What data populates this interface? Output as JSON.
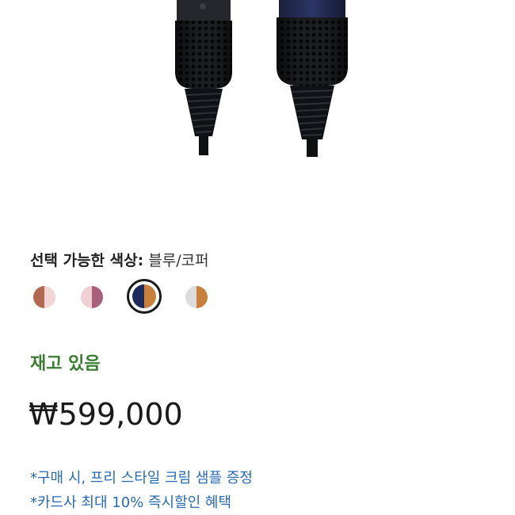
{
  "color_section": {
    "label": "선택 가능한 색상:",
    "selected_value": "블루/코퍼",
    "swatches": [
      {
        "left": "#b06a52",
        "right": "#f2d5d5",
        "selected": false
      },
      {
        "left": "#f0d0d4",
        "right": "#a8607a",
        "selected": false
      },
      {
        "left": "#1f2a5c",
        "right": "#c8803f",
        "selected": true
      },
      {
        "left": "#dcdcdc",
        "right": "#c8803f",
        "selected": false
      }
    ]
  },
  "stock": {
    "status": "재고 있음",
    "color": "#3a7d33"
  },
  "price": {
    "amount": "₩599,000"
  },
  "promotions": [
    "*구매 시, 프리 스타일 크림 샘플 증정",
    "*카드사 최대 10% 즉시할인 혜택"
  ]
}
